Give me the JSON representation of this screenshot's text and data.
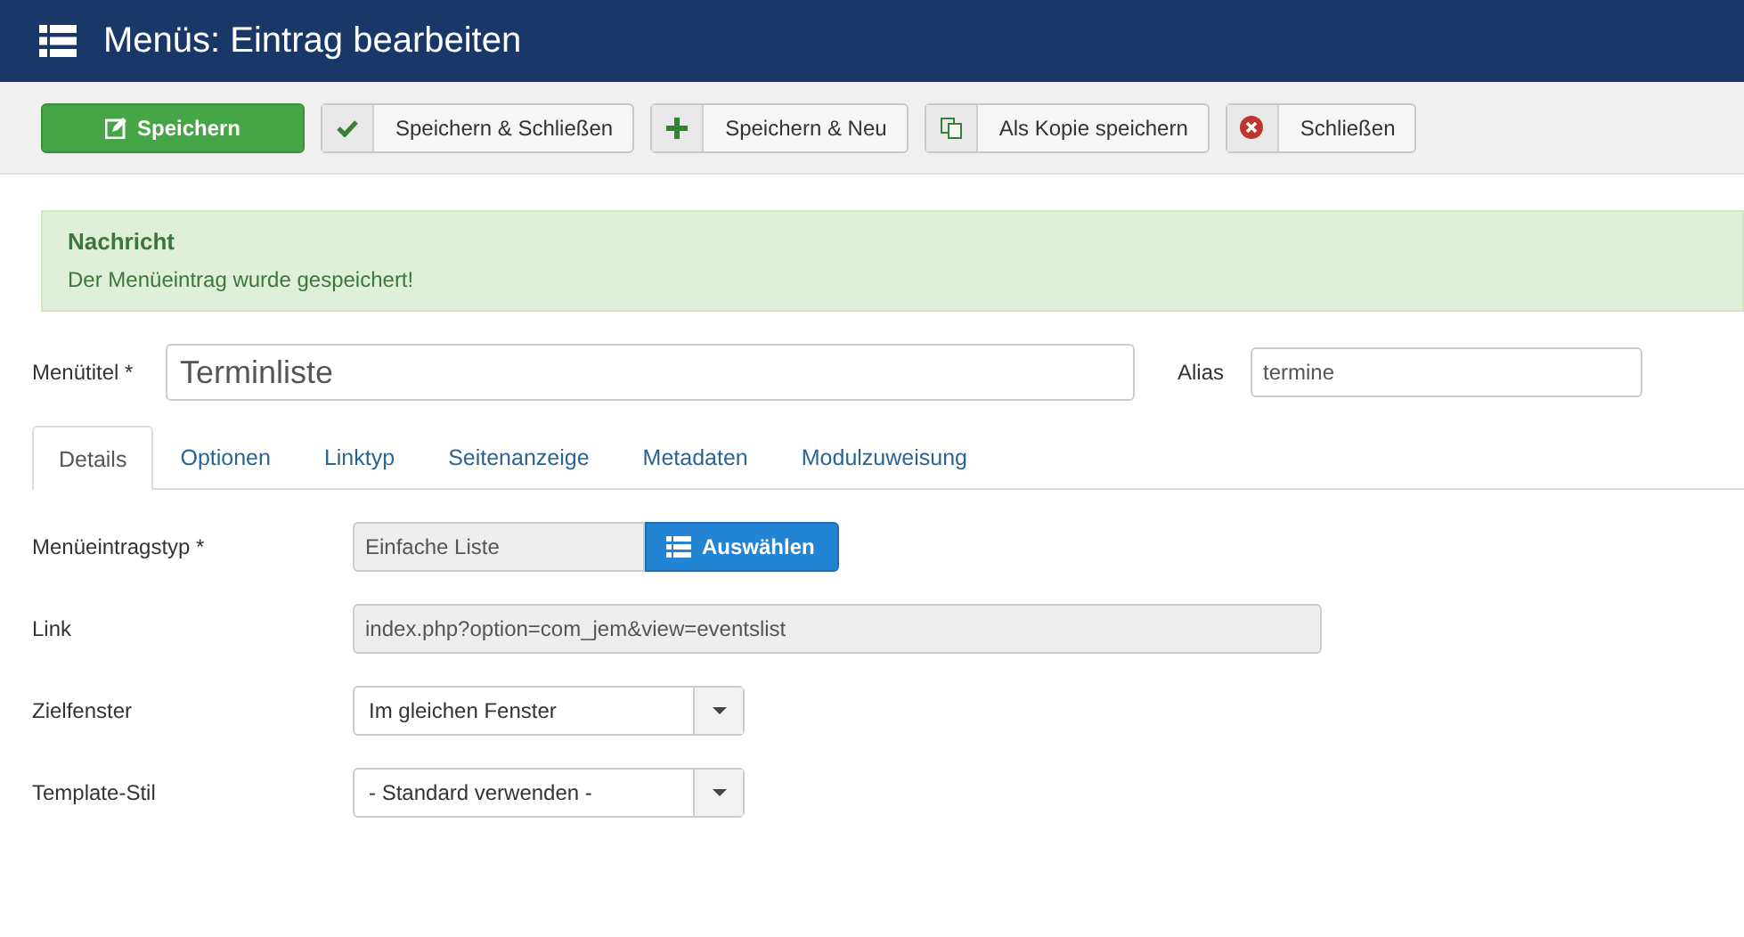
{
  "header": {
    "title": "Menüs: Eintrag bearbeiten"
  },
  "toolbar": [
    {
      "label": "Speichern",
      "kind": "primary"
    },
    {
      "label": "Speichern & Schließen",
      "kind": "default"
    },
    {
      "label": "Speichern & Neu",
      "kind": "default"
    },
    {
      "label": "Als Kopie speichern",
      "kind": "default"
    },
    {
      "label": "Schließen",
      "kind": "default"
    }
  ],
  "message": {
    "heading": "Nachricht",
    "text": "Der Menüeintrag wurde gespeichert!"
  },
  "title_field": {
    "label": "Menütitel *",
    "value": "Terminliste"
  },
  "alias_field": {
    "label": "Alias",
    "value": "termine"
  },
  "tabs": [
    {
      "label": "Details",
      "selected": true
    },
    {
      "label": "Optionen",
      "selected": false
    },
    {
      "label": "Linktyp",
      "selected": false
    },
    {
      "label": "Seitenanzeige",
      "selected": false
    },
    {
      "label": "Metadaten",
      "selected": false
    },
    {
      "label": "Modulzuweisung",
      "selected": false
    }
  ],
  "fields": [
    {
      "label": "Menüeintragstyp *",
      "kind": "picker",
      "value": "Einfache Liste",
      "button": "Auswählen"
    },
    {
      "label": "Link",
      "kind": "readonly",
      "value": "index.php?option=com_jem&view=eventslist"
    },
    {
      "label": "Zielfenster",
      "kind": "dropdown",
      "value": "Im gleichen Fenster"
    },
    {
      "label": "Template-Stil",
      "kind": "dropdown",
      "value": "- Standard verwenden -"
    }
  ]
}
